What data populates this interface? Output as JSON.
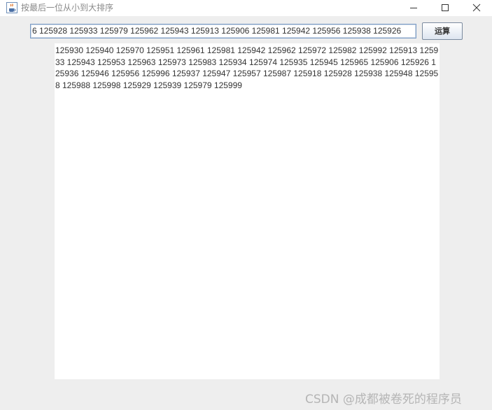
{
  "window": {
    "title": "按最后一位从小到大排序",
    "icon": "java-cup-icon"
  },
  "input": {
    "value": "6 125928 125933 125979 125962 125943 125913 125906 125981 125942 125956 125938 125926"
  },
  "toolbar": {
    "run_label": "运算"
  },
  "result": {
    "text": "125930 125940 125970 125951 125961 125981  125942 125962 125972 125982 125992 125913 125933 125943 125953 125963 125973 125983 125934 125974 125935 125945 125965 125906 125926 125936 125946 125956 125996 125937 125947 125957 125987 125918 125928 125938 125948 125958 125988 125998 125929 125939 125979 125999"
  },
  "watermark": {
    "text": "CSDN @成都被卷死的程序员"
  },
  "colors": {
    "background": "#eeeeee",
    "titlebar": "#ffffff",
    "input_border": "#7a9cc6",
    "text": "#333333",
    "watermark": "#b5b5b5"
  }
}
